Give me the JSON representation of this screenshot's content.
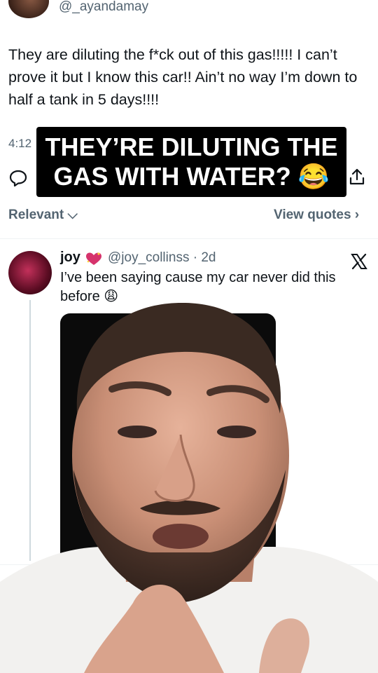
{
  "top_tweet": {
    "handle": "@_ayandamay",
    "text": "They are diluting the f*ck out of this gas!!!!! I can’t prove it but I know this car!! Ain’t no way I’m down to half a tank in 5 days!!!!",
    "time": "4:12"
  },
  "caption": {
    "line1": "THEY’RE DILUTING THE",
    "line2": "GAS WITH WATER? 😂"
  },
  "sort": {
    "label": "Relevant ⌵",
    "view_quotes": "View quotes ›"
  },
  "reply": {
    "name": "joy",
    "handle_time": "@joy_collinss · 2d",
    "text": "I’ve been saying cause my car never did this before 😩"
  },
  "icons": [
    "reply-icon",
    "share-icon",
    "heart-icon",
    "x-logo-icon"
  ],
  "colors": {
    "muted": "#536471",
    "text": "#0f1419",
    "caption_bg": "#000000"
  }
}
